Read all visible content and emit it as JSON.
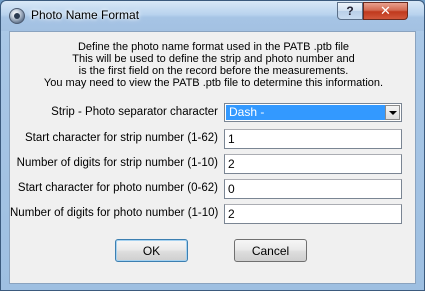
{
  "window": {
    "title": "Photo Name Format",
    "help_label": "?",
    "close_label": "✕"
  },
  "description": {
    "lines": [
      "Define the photo name format used in the PATB .ptb file",
      "This will be used to define the strip and photo number and",
      "is the first field on the record before the measurements.",
      "You may need to view the PATB .ptb file to determine this information."
    ]
  },
  "fields": {
    "separator": {
      "label": "Strip - Photo separator character",
      "value": "Dash -"
    },
    "strip_start": {
      "label": "Start character for strip number (1-62)",
      "value": "1"
    },
    "strip_digits": {
      "label": "Number of digits for strip number (1-10)",
      "value": "2"
    },
    "photo_start": {
      "label": "Start character for photo number (0-62)",
      "value": "0"
    },
    "photo_digits": {
      "label": "Number of digits for photo number (1-10)",
      "value": "2"
    }
  },
  "buttons": {
    "ok": "OK",
    "cancel": "Cancel"
  }
}
